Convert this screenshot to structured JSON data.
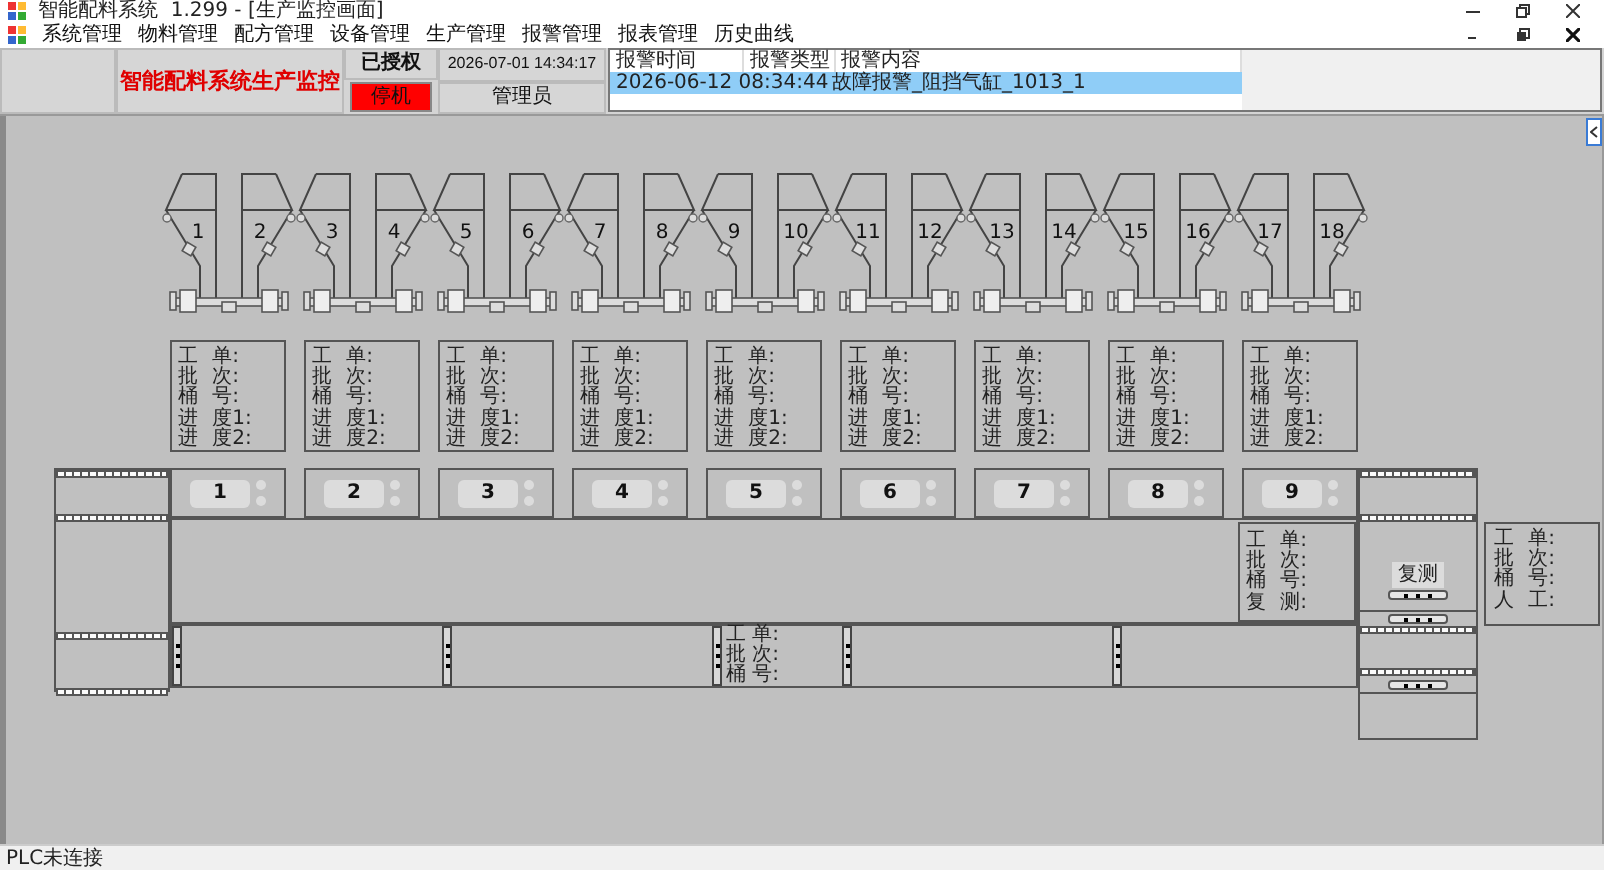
{
  "window": {
    "title": "智能配料系统  1.299 - [生产监控画面]"
  },
  "menu": [
    "系统管理",
    "物料管理",
    "配方管理",
    "设备管理",
    "生产管理",
    "报警管理",
    "报表管理",
    "历史曲线"
  ],
  "header": {
    "title": "智能配料系统生产监控",
    "license": "已授权",
    "run_state": {
      "label": "停机",
      "kind": "stopped"
    },
    "datetime": "2026-07-01 14:34:17",
    "user": "管理员"
  },
  "alarm_table": {
    "columns": [
      "报警时间",
      "报警类型",
      "报警内容"
    ],
    "rows": [
      {
        "time": "2026-06-12 08:34:44",
        "content": "故障报警_阻挡气缸_1013_1",
        "selected": true
      }
    ]
  },
  "hoppers": [
    {
      "numbers": [
        "1",
        "2"
      ]
    },
    {
      "numbers": [
        "3",
        "4"
      ]
    },
    {
      "numbers": [
        "5",
        "6"
      ]
    },
    {
      "numbers": [
        "7",
        "8"
      ]
    },
    {
      "numbers": [
        "9",
        "10"
      ]
    },
    {
      "numbers": [
        "11",
        "12"
      ]
    },
    {
      "numbers": [
        "13",
        "14"
      ]
    },
    {
      "numbers": [
        "15",
        "16"
      ]
    },
    {
      "numbers": [
        "17",
        "18"
      ]
    }
  ],
  "info_panels": [
    {
      "labels": [
        "工 单:",
        "批 次:",
        "桶 号:",
        "进 度1:",
        "进 度2:"
      ]
    },
    {
      "labels": [
        "工 单:",
        "批 次:",
        "桶 号:",
        "进 度1:",
        "进 度2:"
      ]
    },
    {
      "labels": [
        "工 单:",
        "批 次:",
        "桶 号:",
        "进 度1:",
        "进 度2:"
      ]
    },
    {
      "labels": [
        "工 单:",
        "批 次:",
        "桶 号:",
        "进 度1:",
        "进 度2:"
      ]
    },
    {
      "labels": [
        "工 单:",
        "批 次:",
        "桶 号:",
        "进 度1:",
        "进 度2:"
      ]
    },
    {
      "labels": [
        "工 单:",
        "批 次:",
        "桶 号:",
        "进 度1:",
        "进 度2:"
      ]
    },
    {
      "labels": [
        "工 单:",
        "批 次:",
        "桶 号:",
        "进 度1:",
        "进 度2:"
      ]
    },
    {
      "labels": [
        "工 单:",
        "批 次:",
        "桶 号:",
        "进 度1:",
        "进 度2:"
      ]
    },
    {
      "labels": [
        "工 单:",
        "批 次:",
        "桶 号:",
        "进 度1:",
        "进 度2:"
      ]
    }
  ],
  "stations": [
    "1",
    "2",
    "3",
    "4",
    "5",
    "6",
    "7",
    "8",
    "9"
  ],
  "conveyor_info": {
    "labels": [
      "工 单:",
      "批 次:",
      "桶 号:"
    ]
  },
  "recheck_panel": {
    "labels": [
      "工 单:",
      "批 次:",
      "桶 号:",
      "复 测:"
    ]
  },
  "recheck_button": "复测",
  "manual_panel": {
    "labels": [
      "工 单:",
      "批 次:",
      "桶 号:",
      "人 工:"
    ]
  },
  "status_bar": {
    "text": "PLC未连接"
  }
}
